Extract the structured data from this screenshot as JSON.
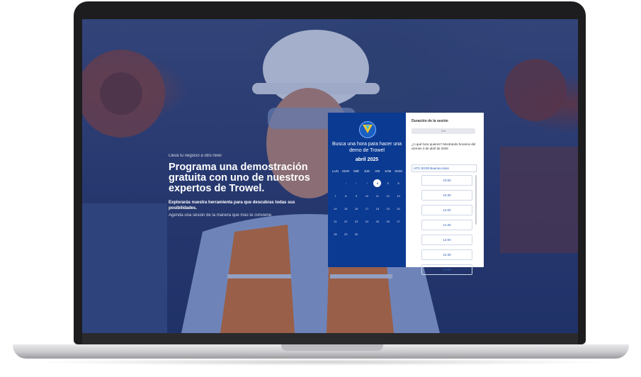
{
  "hero": {
    "eyebrow": "Lleva tu negocio a otro nivel",
    "headline": "Programa una demostración gratuita con uno de nuestros expertos de Trowel.",
    "subline": "Explorarás nuestra herramienta para que descubras todas sus posibilidades.",
    "subline2": "Agenda una sesión de la manera que más te conviene."
  },
  "calendar": {
    "title": "Busca una hora para hacer una demo de Trowel",
    "month": "abril 2025",
    "weekdays": [
      "LUN",
      "MAR",
      "MIÉ",
      "JUE",
      "VIE",
      "SÁB",
      "DOM"
    ],
    "days": [
      "",
      "1",
      "2",
      "3",
      "4",
      "5",
      "6",
      "7",
      "8",
      "9",
      "10",
      "11",
      "12",
      "13",
      "14",
      "15",
      "16",
      "17",
      "18",
      "19",
      "20",
      "21",
      "22",
      "23",
      "24",
      "25",
      "26",
      "27",
      "28",
      "29",
      "30"
    ],
    "selected_day": "4"
  },
  "slots": {
    "duration_label": "Duración de la sesión",
    "duration_value": "1 h",
    "question": "¿A qué hora quieres? Mostrando horarios del viernes 4 de abril de 2025",
    "timezone": "UTC-03:00 Buenos Aires",
    "times": [
      "10:00",
      "10:30",
      "11:00",
      "11:30",
      "12:00",
      "12:30",
      "13:00"
    ]
  }
}
